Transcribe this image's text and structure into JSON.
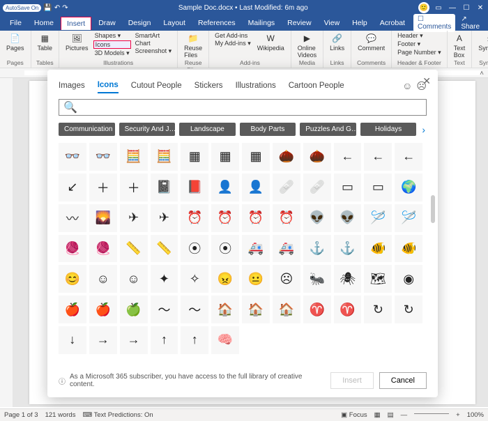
{
  "titlebar": {
    "autosave_label": "AutoSave",
    "autosave_state": "On",
    "title": "Sample Doc.docx • Last Modified: 6m ago"
  },
  "ribbon_tabs": [
    "File",
    "Home",
    "Insert",
    "Draw",
    "Design",
    "Layout",
    "References",
    "Mailings",
    "Review",
    "View",
    "Help",
    "Acrobat"
  ],
  "ribbon_active": "Insert",
  "ribbon_right": {
    "comments": "Comments",
    "share": "Share"
  },
  "ribbon_groups": {
    "pages": {
      "label": "Pages",
      "btn": "Pages"
    },
    "tables": {
      "label": "Tables",
      "btn": "Table"
    },
    "illustrations": {
      "label": "Illustrations",
      "btn": "Pictures",
      "col": [
        "Shapes ▾",
        "Icons",
        "3D Models ▾"
      ],
      "col2": [
        "SmartArt",
        "Chart",
        "Screenshot ▾"
      ]
    },
    "reuse": {
      "label": "Reuse Files",
      "btn": "Reuse\nFiles"
    },
    "addins": {
      "label": "Add-ins",
      "col": [
        "Get Add-ins",
        "My Add-ins ▾"
      ],
      "wiki": "Wikipedia"
    },
    "media": {
      "label": "Media",
      "btn": "Online\nVideos"
    },
    "links": {
      "label": "Links",
      "btn": "Links"
    },
    "comments": {
      "label": "Comments",
      "btn": "Comment"
    },
    "headerfooter": {
      "label": "Header & Footer",
      "col": [
        "Header ▾",
        "Footer ▾",
        "Page Number ▾"
      ]
    },
    "text": {
      "label": "Text",
      "btn": "Text\nBox"
    },
    "symbols": {
      "label": "Symbols",
      "btn": "Symbols"
    }
  },
  "dialog": {
    "tabs": [
      "Images",
      "Icons",
      "Cutout People",
      "Stickers",
      "Illustrations",
      "Cartoon People"
    ],
    "active_tab": "Icons",
    "search_placeholder": "",
    "categories": [
      "Communication",
      "Security And J…",
      "Landscape",
      "Body Parts",
      "Puzzles And G…",
      "Holidays"
    ],
    "footer_info": "As a Microsoft 365 subscriber, you have access to the full library of creative content.",
    "insert_btn": "Insert",
    "cancel_btn": "Cancel",
    "icons": [
      "glasses",
      "glasses-o",
      "abacus",
      "abacus-o",
      "grid",
      "grid-o",
      "grid2",
      "acorn",
      "acorn-o",
      "arrow-l",
      "arrow-l2",
      "arrow-l3",
      "arrow-bl",
      "plus",
      "plus-o",
      "book",
      "book2",
      "book3",
      "book4",
      "bandage",
      "bandage-o",
      "billboard",
      "bb2",
      "africa",
      "waves",
      "field",
      "plane",
      "plane-o",
      "alarm",
      "alarm-o",
      "alarm2",
      "alarm3",
      "alien",
      "alien-o",
      "needle",
      "needle2",
      "yarn",
      "yarn2",
      "tape",
      "tape-o",
      "button",
      "button-o",
      "ambulance",
      "amb-o",
      "anchor",
      "anchor2",
      "fish",
      "fish2",
      "smile",
      "smile-o",
      "smile2",
      "spark",
      "spark-o",
      "angry",
      "neutral",
      "sad",
      "ant",
      "spider",
      "antarctica",
      "aperture",
      "apple",
      "apple-o",
      "apple2",
      "wave",
      "wave2",
      "home",
      "home2",
      "home3",
      "aries",
      "aries-o",
      "cycle",
      "cycle-o",
      "down",
      "right",
      "right-o",
      "up",
      "up-o",
      "brain"
    ]
  },
  "statusbar": {
    "page": "Page 1 of 3",
    "words": "121 words",
    "predictions": "Text Predictions: On",
    "focus": "Focus",
    "zoom": "100%"
  }
}
